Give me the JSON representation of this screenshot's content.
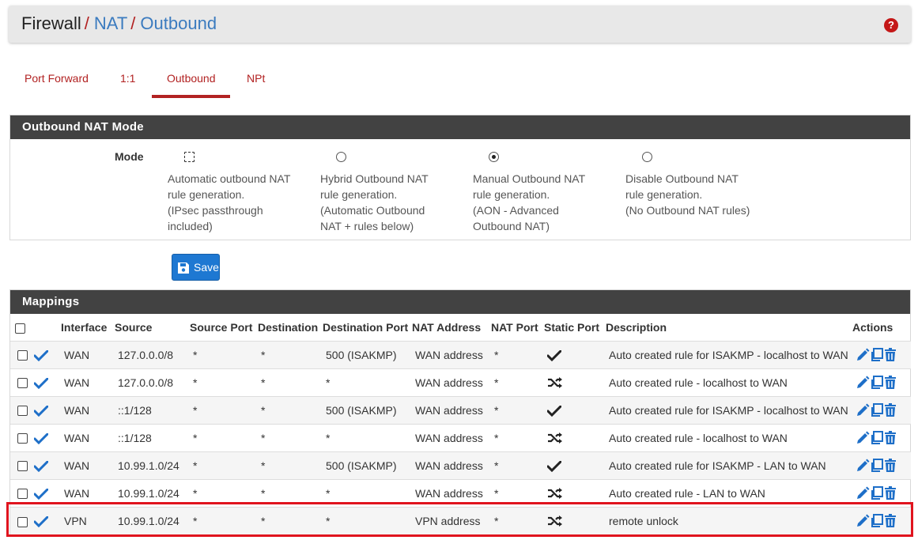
{
  "breadcrumb": {
    "root": "Firewall",
    "level2": "NAT",
    "level3": "Outbound"
  },
  "tabs": [
    {
      "label": "Port Forward"
    },
    {
      "label": "1:1"
    },
    {
      "label": "Outbound"
    },
    {
      "label": "NPt"
    }
  ],
  "active_tab": "Outbound",
  "mode_panel": {
    "title": "Outbound NAT Mode",
    "label": "Mode",
    "options": [
      {
        "line1": "Automatic outbound NAT",
        "line2": "rule generation.",
        "line3": "(IPsec passthrough",
        "line4": "included)"
      },
      {
        "line1": "Hybrid Outbound NAT",
        "line2": "rule generation.",
        "line3": "(Automatic Outbound",
        "line4": "NAT + rules below)"
      },
      {
        "line1": "Manual Outbound NAT",
        "line2": "rule generation.",
        "line3": "(AON - Advanced",
        "line4": "Outbound NAT)"
      },
      {
        "line1": "Disable Outbound NAT",
        "line2": "rule generation.",
        "line3": "(No Outbound NAT rules)",
        "line4": ""
      }
    ],
    "selected": "Manual Outbound NAT"
  },
  "save_label": "Save",
  "mappings": {
    "title": "Mappings",
    "columns": {
      "interface": "Interface",
      "source": "Source",
      "source_port": "Source Port",
      "destination": "Destination",
      "destination_port": "Destination Port",
      "nat_address": "NAT Address",
      "nat_port": "NAT Port",
      "static_port": "Static Port",
      "description": "Description",
      "actions": "Actions"
    },
    "rows": [
      {
        "interface": "WAN",
        "source": "127.0.0.0/8",
        "source_port": "*",
        "destination": "*",
        "destination_port": "500 (ISAKMP)",
        "nat_address": "WAN address",
        "nat_port": "*",
        "static_port": "check-icon",
        "description": "Auto created rule for ISAKMP - localhost to WAN"
      },
      {
        "interface": "WAN",
        "source": "127.0.0.0/8",
        "source_port": "*",
        "destination": "*",
        "destination_port": "*",
        "nat_address": "WAN address",
        "nat_port": "*",
        "static_port": "shuffle-icon",
        "description": "Auto created rule - localhost to WAN"
      },
      {
        "interface": "WAN",
        "source": "::1/128",
        "source_port": "*",
        "destination": "*",
        "destination_port": "500 (ISAKMP)",
        "nat_address": "WAN address",
        "nat_port": "*",
        "static_port": "check-icon",
        "description": "Auto created rule for ISAKMP - localhost to WAN"
      },
      {
        "interface": "WAN",
        "source": "::1/128",
        "source_port": "*",
        "destination": "*",
        "destination_port": "*",
        "nat_address": "WAN address",
        "nat_port": "*",
        "static_port": "shuffle-icon",
        "description": "Auto created rule - localhost to WAN"
      },
      {
        "interface": "WAN",
        "source": "10.99.1.0/24",
        "source_port": "*",
        "destination": "*",
        "destination_port": "500 (ISAKMP)",
        "nat_address": "WAN address",
        "nat_port": "*",
        "static_port": "check-icon",
        "description": "Auto created rule for ISAKMP - LAN to WAN"
      },
      {
        "interface": "WAN",
        "source": "10.99.1.0/24",
        "source_port": "*",
        "destination": "*",
        "destination_port": "*",
        "nat_address": "WAN address",
        "nat_port": "*",
        "static_port": "shuffle-icon",
        "description": "Auto created rule - LAN to WAN"
      },
      {
        "interface": "VPN",
        "source": "10.99.1.0/24",
        "source_port": "*",
        "destination": "*",
        "destination_port": "*",
        "nat_address": "VPN address",
        "nat_port": "*",
        "static_port": "shuffle-icon",
        "description": "remote unlock"
      }
    ]
  },
  "colors": {
    "accent_red": "#b22222",
    "link_blue": "#3b7bbf",
    "panel_header": "#424242",
    "highlight": "#e0141e",
    "save_blue": "#1e78d2"
  }
}
